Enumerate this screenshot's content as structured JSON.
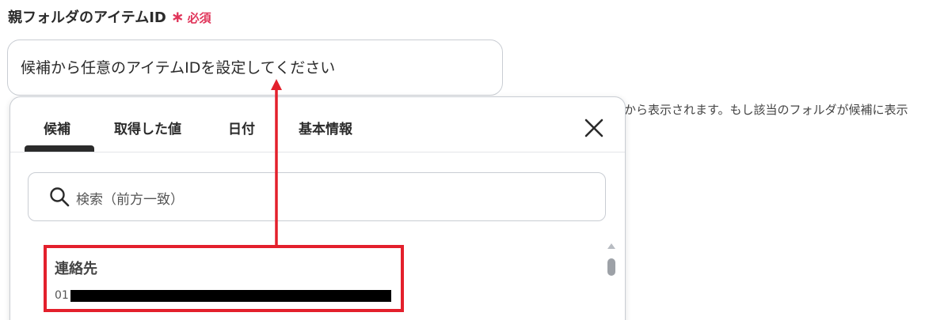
{
  "field": {
    "label": "親フォルダのアイテムID",
    "required_mark": "∗",
    "required_text": "必須"
  },
  "main_input": {
    "placeholder": "候補から任意のアイテムIDを設定してください"
  },
  "help_text": "から表示されます。もし該当のフォルダが候補に表示",
  "popup": {
    "tabs": [
      {
        "label": "候補",
        "active": true
      },
      {
        "label": "取得した値",
        "active": false
      },
      {
        "label": "日付",
        "active": false
      },
      {
        "label": "基本情報",
        "active": false
      }
    ],
    "search_placeholder": "検索（前方一致）",
    "items": [
      {
        "title": "連絡先",
        "id_prefix": "01"
      }
    ]
  },
  "colors": {
    "required": "#e0355a",
    "highlight": "#e3202c"
  }
}
